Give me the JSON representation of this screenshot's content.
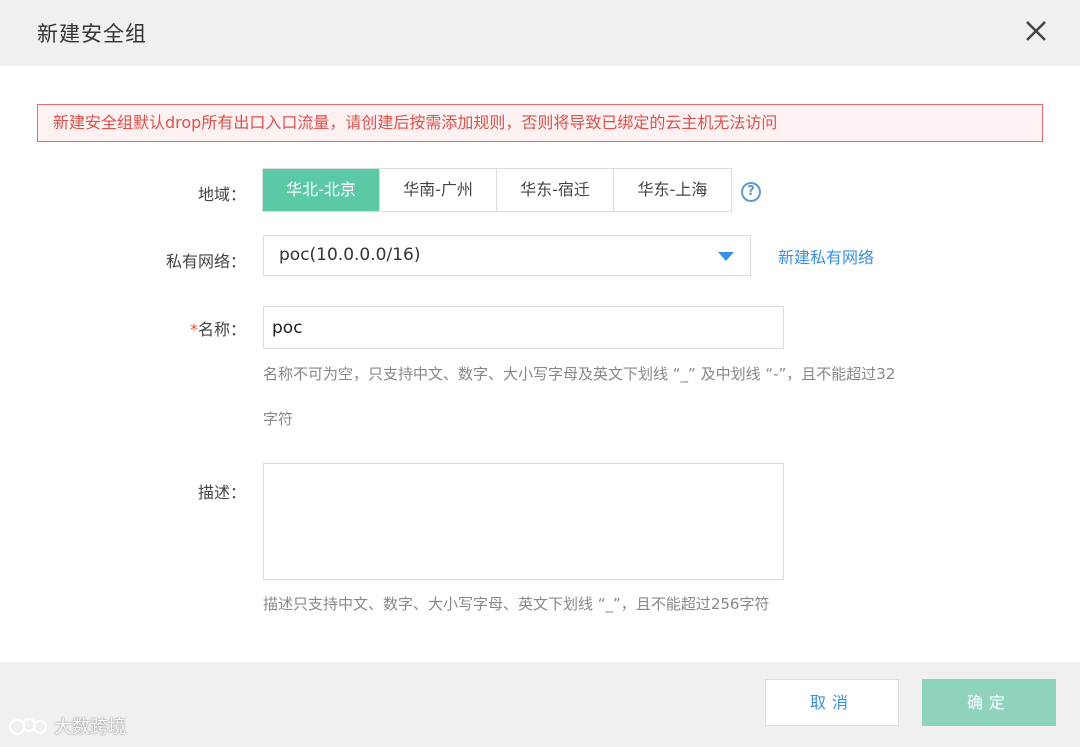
{
  "dialog": {
    "title": "新建安全组",
    "alert": "新建安全组默认drop所有出口入口流量，请创建后按需添加规则，否则将导致已绑定的云主机无法访问"
  },
  "region": {
    "label": "地域：",
    "options": [
      "华北-北京",
      "华南-广州",
      "华东-宿迁",
      "华东-上海"
    ],
    "selected": "华北-北京",
    "help_icon": "?"
  },
  "vpc": {
    "label": "私有网络：",
    "value": "poc(10.0.0.0/16)",
    "create_link": "新建私有网络"
  },
  "name": {
    "required_mark": "*",
    "label": "名称：",
    "value": "poc",
    "hint_line1": "名称不可为空，只支持中文、数字、大小写字母及英文下划线 “_” 及中划线 “-”，且不能超过32",
    "hint_line2": "字符"
  },
  "description": {
    "label": "描述：",
    "value": "",
    "hint": "描述只支持中文、数字、大小写字母、英文下划线 “_”，且不能超过256字符"
  },
  "buttons": {
    "cancel": "取消",
    "ok": "确定"
  },
  "watermark": {
    "text": "大数跨境"
  },
  "colors": {
    "accent": "#5bc8a8",
    "link": "#3b8fe0",
    "alert_border": "#e46c6c",
    "alert_text": "#d9534f"
  }
}
